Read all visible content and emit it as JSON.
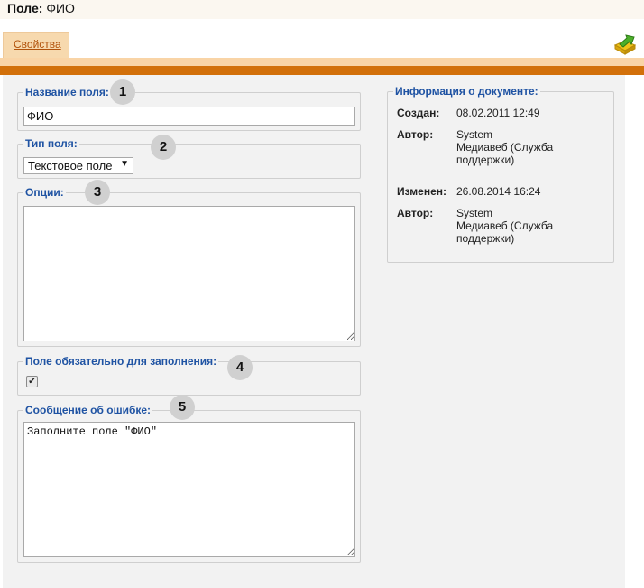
{
  "title": {
    "label": "Поле:",
    "value": "ФИО"
  },
  "tabs": [
    {
      "label": "Свойства"
    }
  ],
  "toolbar": {
    "export_icon": "export-arrow-icon"
  },
  "fields": {
    "name": {
      "legend": "Название поля:",
      "value": "ФИО",
      "badge": "1"
    },
    "type": {
      "legend": "Тип поля:",
      "selected": "Текстовое поле",
      "badge": "2"
    },
    "options": {
      "legend": "Опции:",
      "value": "",
      "badge": "3"
    },
    "required": {
      "legend": "Поле обязательно для заполнения:",
      "checked": true,
      "badge": "4"
    },
    "error": {
      "legend": "Сообщение об ошибке:",
      "value": "Заполните поле \"ФИО\"",
      "badge": "5"
    }
  },
  "doc_info": {
    "legend": "Информация о документе:",
    "created_label": "Создан:",
    "created_value": "08.02.2011 12:49",
    "author1_label": "Автор:",
    "author1_value": "System\nМедиавеб (Служба\nподдержки)",
    "modified_label": "Изменен:",
    "modified_value": "26.08.2014 16:24",
    "author2_label": "Автор:",
    "author2_value": "System\nМедиавеб (Служба\nподдержки)"
  },
  "colors": {
    "accent": "#d2700a",
    "legend": "#1f53a3",
    "tab": "#f7d9ae"
  }
}
